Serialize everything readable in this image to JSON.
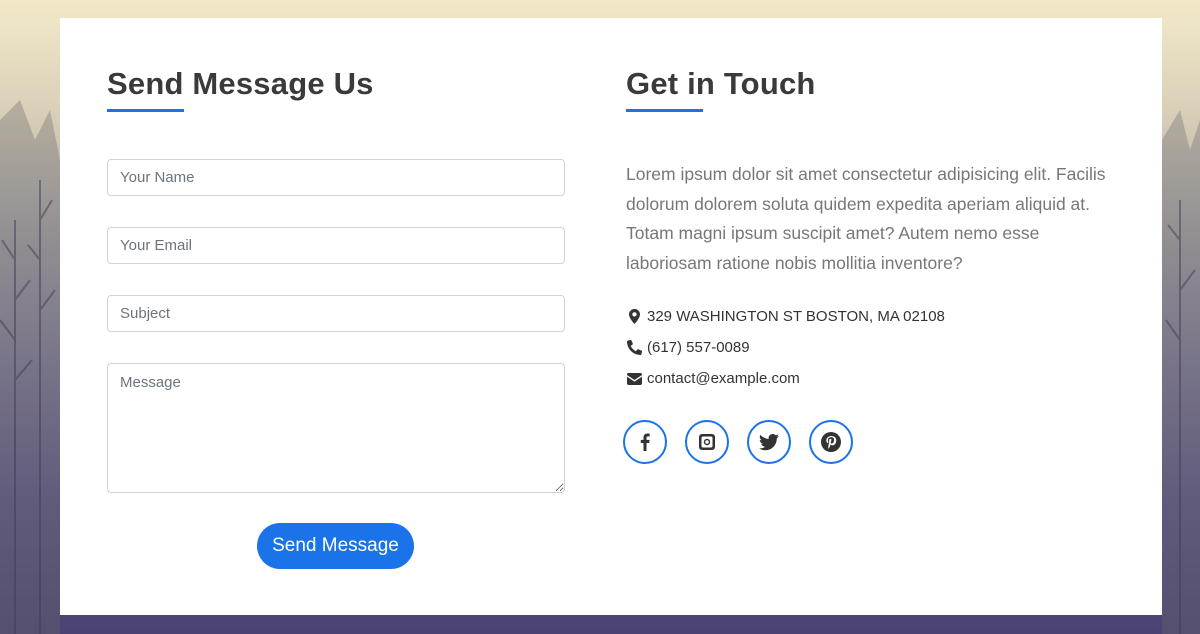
{
  "form": {
    "heading": "Send Message Us",
    "name_placeholder": "Your Name",
    "email_placeholder": "Your Email",
    "subject_placeholder": "Subject",
    "message_placeholder": "Message",
    "submit_label": "Send Message"
  },
  "contact": {
    "heading": "Get in Touch",
    "description": "Lorem ipsum dolor sit amet consectetur adipisicing elit. Facilis dolorum dolorem soluta quidem expedita aperiam aliquid at. Totam magni ipsum suscipit amet? Autem nemo esse laboriosam ratione nobis mollitia inventore?",
    "address": "329 WASHINGTON ST BOSTON, MA 02108",
    "phone": "(617) 557-0089",
    "email": "contact@example.com",
    "icons": {
      "address": "map-marker-icon",
      "phone": "phone-icon",
      "email": "envelope-icon"
    },
    "social": [
      "facebook-icon",
      "instagram-icon",
      "twitter-icon",
      "pinterest-icon"
    ]
  },
  "colors": {
    "accent": "#1a73e8",
    "heading_text": "#3a3a3a",
    "body_text": "#777777"
  }
}
